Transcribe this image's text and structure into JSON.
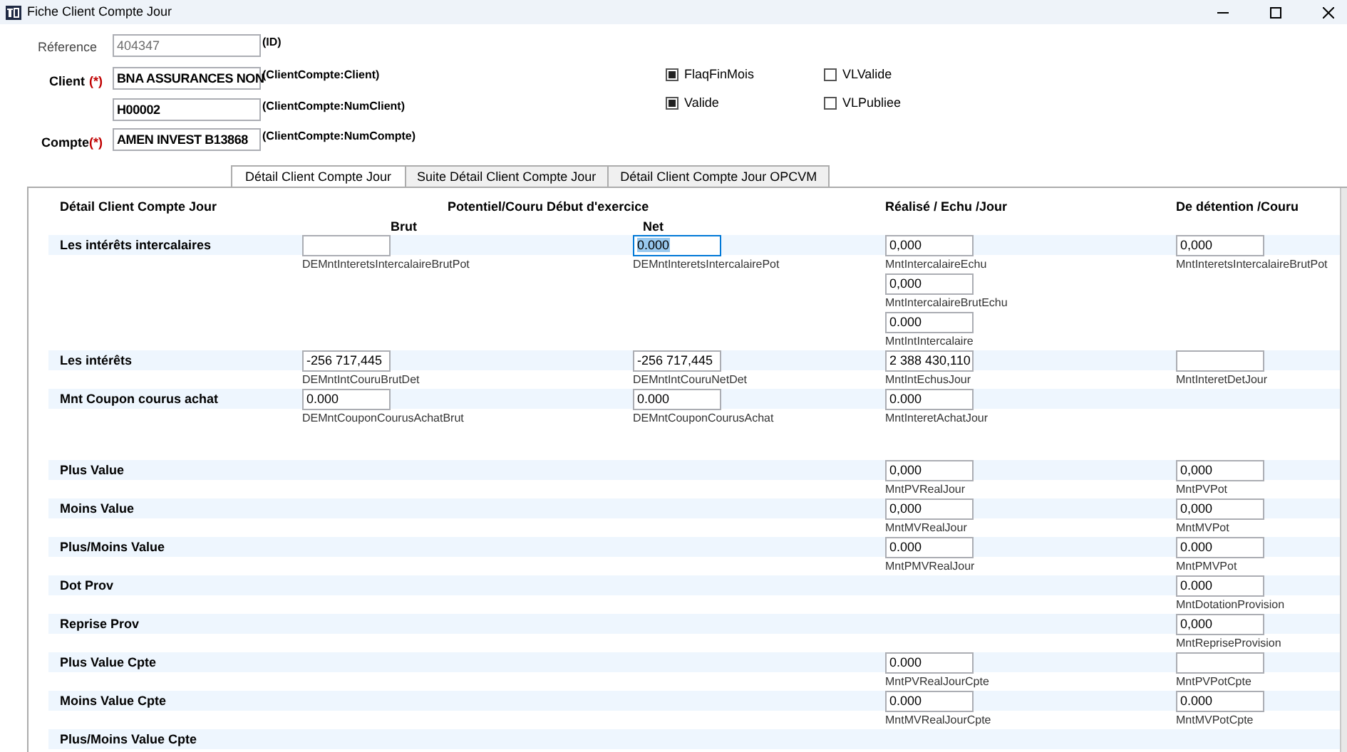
{
  "window": {
    "title": "Fiche Client Compte Jour"
  },
  "header": {
    "reference": {
      "label": "Réference",
      "value": "404347",
      "note": "(ID)",
      "readonly": true
    },
    "client": {
      "label": "Client",
      "required_mark": "(*)",
      "fields": [
        {
          "value": "BNA ASSURANCES NON",
          "note": "(ClientCompte:Client)",
          "readonly": false
        },
        {
          "value": "H00002",
          "note": "(ClientCompte:NumClient)",
          "readonly": false
        }
      ]
    },
    "compte": {
      "label": "Compte",
      "required_mark": "(*)",
      "fields": [
        {
          "value": "AMEN INVEST B13868",
          "note": "(ClientCompte:NumCompte)",
          "readonly": false
        }
      ]
    }
  },
  "checkboxes": [
    {
      "label": "FlaqFinMois",
      "checked": true
    },
    {
      "label": "VLValide",
      "checked": false
    },
    {
      "label": "Valide",
      "checked": true
    },
    {
      "label": "VLPubliee",
      "checked": false
    }
  ],
  "tabs": [
    {
      "label": "Détail Client Compte Jour",
      "selected": true
    },
    {
      "label": "Suite Détail Client Compte Jour",
      "selected": false
    },
    {
      "label": "Détail Client Compte Jour OPCVM",
      "selected": false
    }
  ],
  "panel": {
    "title": "Détail Client Compte Jour",
    "group_header": "Potentiel/Couru Début d'exercice",
    "column_headers": [
      "Brut",
      "Net",
      "Réalisé / Echu /Jour",
      "De détention /Couru"
    ],
    "sections": [
      [
        {
          "label": "Les intérêts intercalaires",
          "cells": [
            [
              {
                "caption": "DEMntInteretsIntercalaireBrutPot",
                "selected": false
              }
            ],
            [
              {
                "value": "0.000",
                "caption": "DEMntInteretsIntercalairePot",
                "selected": true
              }
            ],
            [
              {
                "value": "0,000",
                "caption": "MntIntercalaireEchu",
                "selected": false
              },
              {
                "value": "0,000",
                "caption": "MntIntercalaireBrutEchu",
                "selected": false
              },
              {
                "value": "0.000",
                "caption": "MntIntIntercalaire",
                "selected": false
              }
            ],
            [
              {
                "value": "0,000",
                "caption": "MntInteretsIntercalaireBrutPot",
                "selected": false
              }
            ]
          ]
        },
        {
          "label": "Les intérêts",
          "cells": [
            [
              {
                "value": "-256 717,445",
                "caption": "DEMntIntCouruBrutDet",
                "selected": false
              }
            ],
            [
              {
                "value": "-256 717,445",
                "caption": "DEMntIntCouruNetDet",
                "selected": false
              }
            ],
            [
              {
                "value": "2 388 430,110",
                "caption": "MntIntEchusJour",
                "selected": false
              }
            ],
            [
              {
                "caption": "MntInteretDetJour",
                "selected": false
              }
            ]
          ]
        },
        {
          "label": "Mnt Coupon courus achat",
          "cells": [
            [
              {
                "value": "0.000",
                "caption": "DEMntCouponCourusAchatBrut",
                "selected": false
              }
            ],
            [
              {
                "value": "0.000",
                "caption": "DEMntCouponCourusAchat",
                "selected": false
              }
            ],
            [
              {
                "value": "0.000",
                "caption": "MntInteretAchatJour",
                "selected": false
              }
            ],
            []
          ]
        }
      ],
      [
        {
          "label": "Plus Value",
          "cells": [
            [],
            [],
            [
              {
                "value": "0,000",
                "caption": "MntPVRealJour",
                "selected": false
              }
            ],
            [
              {
                "value": "0,000",
                "caption": "MntPVPot",
                "selected": false
              }
            ]
          ]
        },
        {
          "label": "Moins Value",
          "cells": [
            [],
            [],
            [
              {
                "value": "0,000",
                "caption": "MntMVRealJour",
                "selected": false
              }
            ],
            [
              {
                "value": "0,000",
                "caption": "MntMVPot",
                "selected": false
              }
            ]
          ]
        },
        {
          "label": "Plus/Moins Value",
          "cells": [
            [],
            [],
            [
              {
                "value": "0.000",
                "caption": "MntPMVRealJour",
                "selected": false
              }
            ],
            [
              {
                "value": "0.000",
                "caption": "MntPMVPot",
                "selected": false
              }
            ]
          ]
        },
        {
          "label": "Dot Prov",
          "cells": [
            [],
            [],
            [],
            [
              {
                "value": "0.000",
                "caption": "MntDotationProvision",
                "selected": false
              }
            ]
          ]
        },
        {
          "label": "Reprise Prov",
          "cells": [
            [],
            [],
            [],
            [
              {
                "value": "0,000",
                "caption": "MntRepriseProvision",
                "selected": false
              }
            ]
          ]
        },
        {
          "label": "Plus Value Cpte",
          "cells": [
            [],
            [],
            [
              {
                "value": "0.000",
                "caption": "MntPVRealJourCpte",
                "selected": false
              }
            ],
            [
              {
                "caption": "MntPVPotCpte",
                "selected": false
              }
            ]
          ]
        },
        {
          "label": "Moins Value Cpte",
          "cells": [
            [],
            [],
            [
              {
                "value": "0.000",
                "caption": "MntMVRealJourCpte",
                "selected": false
              }
            ],
            [
              {
                "value": "0.000",
                "caption": "MntMVPotCpte",
                "selected": false
              }
            ]
          ]
        },
        {
          "label": "Plus/Moins Value Cpte",
          "cells": [
            [],
            [],
            [],
            []
          ]
        }
      ]
    ]
  }
}
